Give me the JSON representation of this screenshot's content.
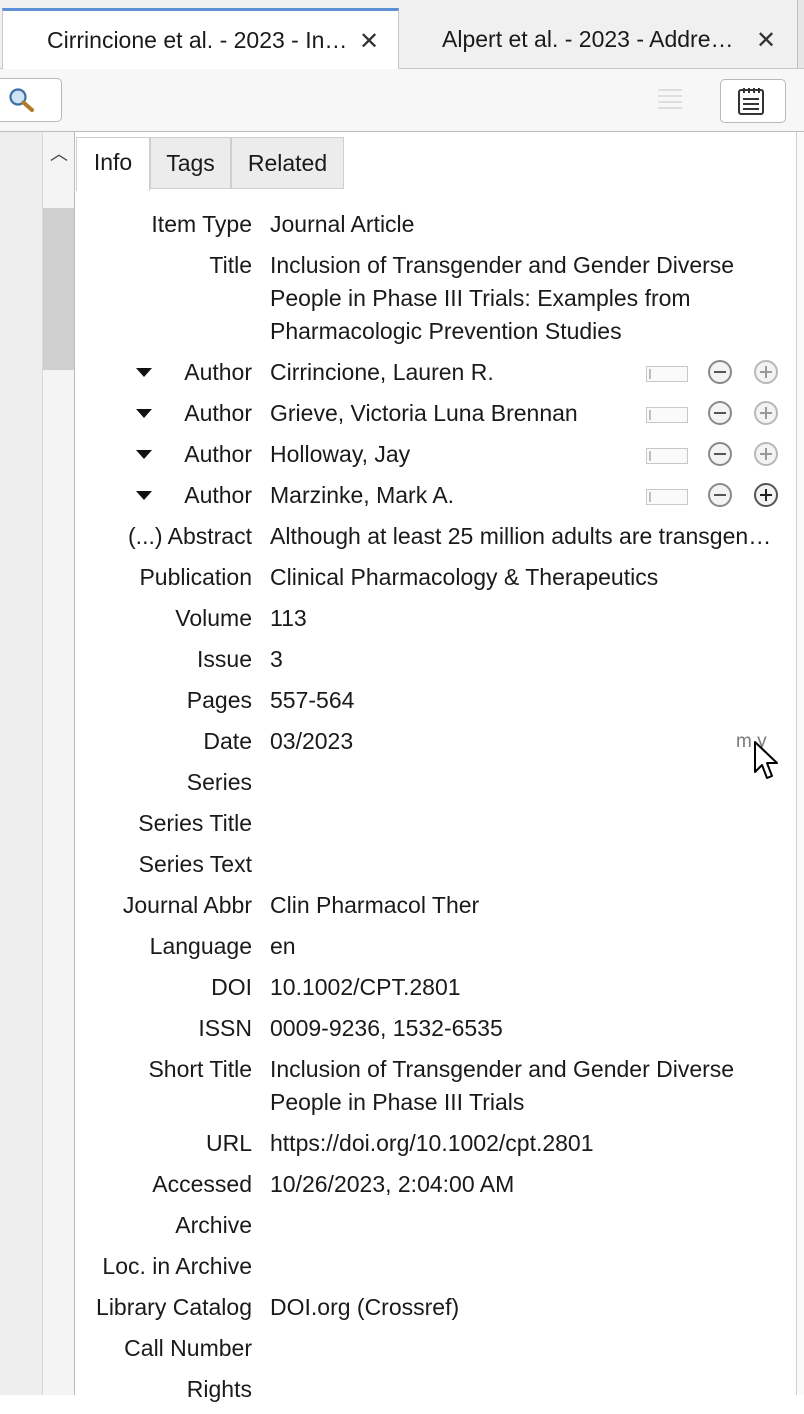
{
  "tabs": [
    {
      "label": "Cirrincione et al. - 2023 - In…",
      "close": "✕"
    },
    {
      "label": "Alpert et al. - 2023 - Addre…",
      "close": "✕"
    }
  ],
  "pane_tabs": [
    "Info",
    "Tags",
    "Related"
  ],
  "fields": {
    "item_type": {
      "label": "Item Type",
      "value": "Journal Article"
    },
    "title": {
      "label": "Title",
      "value": "Inclusion of Transgender and Gender Diverse People in Phase III Trials: Examples from Pharmacologic Prevention Studies"
    },
    "authors": [
      {
        "label": "Author",
        "value": "Cirrincione, Lauren R."
      },
      {
        "label": "Author",
        "value": "Grieve, Victoria Luna Brennan"
      },
      {
        "label": "Author",
        "value": "Holloway, Jay"
      },
      {
        "label": "Author",
        "value": "Marzinke, Mark A."
      }
    ],
    "abstract": {
      "label": "(...) Abstract",
      "value": "Although at least 25 million adults are transgender"
    },
    "publication": {
      "label": "Publication",
      "value": "Clinical Pharmacology & Therapeutics"
    },
    "volume": {
      "label": "Volume",
      "value": "113"
    },
    "issue": {
      "label": "Issue",
      "value": "3"
    },
    "pages": {
      "label": "Pages",
      "value": "557-564"
    },
    "date": {
      "label": "Date",
      "value": "03/2023",
      "format": "m y"
    },
    "series": {
      "label": "Series",
      "value": ""
    },
    "series_title": {
      "label": "Series Title",
      "value": ""
    },
    "series_text": {
      "label": "Series Text",
      "value": ""
    },
    "journal_abbr": {
      "label": "Journal Abbr",
      "value": "Clin Pharmacol Ther"
    },
    "language": {
      "label": "Language",
      "value": "en"
    },
    "doi": {
      "label": "DOI",
      "value": "10.1002/CPT.2801"
    },
    "issn": {
      "label": "ISSN",
      "value": "0009-9236, 1532-6535"
    },
    "short_title": {
      "label": "Short Title",
      "value": "Inclusion of Transgender and Gender Diverse People in Phase III Trials"
    },
    "url": {
      "label": "URL",
      "value": "https://doi.org/10.1002/cpt.2801"
    },
    "accessed": {
      "label": "Accessed",
      "value": "10/26/2023, 2:04:00 AM"
    },
    "archive": {
      "label": "Archive",
      "value": ""
    },
    "loc_in_archive": {
      "label": "Loc. in Archive",
      "value": ""
    },
    "library_catalog": {
      "label": "Library Catalog",
      "value": "DOI.org (Crossref)"
    },
    "call_number": {
      "label": "Call Number",
      "value": ""
    },
    "rights": {
      "label": "Rights",
      "value": ""
    }
  },
  "icons": {
    "search": "magnifier-icon",
    "notes": "notes-icon",
    "list": "list-icon",
    "scroll_up": "chevron-up-icon"
  },
  "colors": {
    "active_tab_accent": "#5b8fd6"
  }
}
